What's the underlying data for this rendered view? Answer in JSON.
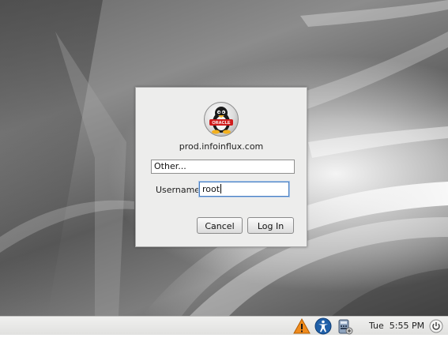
{
  "login": {
    "hostname": "prod.infoinflux.com",
    "user_select_value": "Other...",
    "username_label": "Username:",
    "username_value": "root",
    "cancel_label": "Cancel",
    "login_label": "Log In",
    "logo_icon": "oracle-tux-logo-icon",
    "logo_text": "ORACLE"
  },
  "panel": {
    "clock": "Tue  5:55 PM",
    "tray_icons": [
      "warning-icon",
      "accessibility-icon",
      "keyboard-layout-icon",
      "power-icon"
    ]
  },
  "colors": {
    "dialog_bg": "#ededec",
    "panel_bg": "#e8e8e6",
    "focus_border": "#4a7fc1",
    "warning_orange": "#f08b1c",
    "accessibility_blue": "#1f5fa8"
  }
}
